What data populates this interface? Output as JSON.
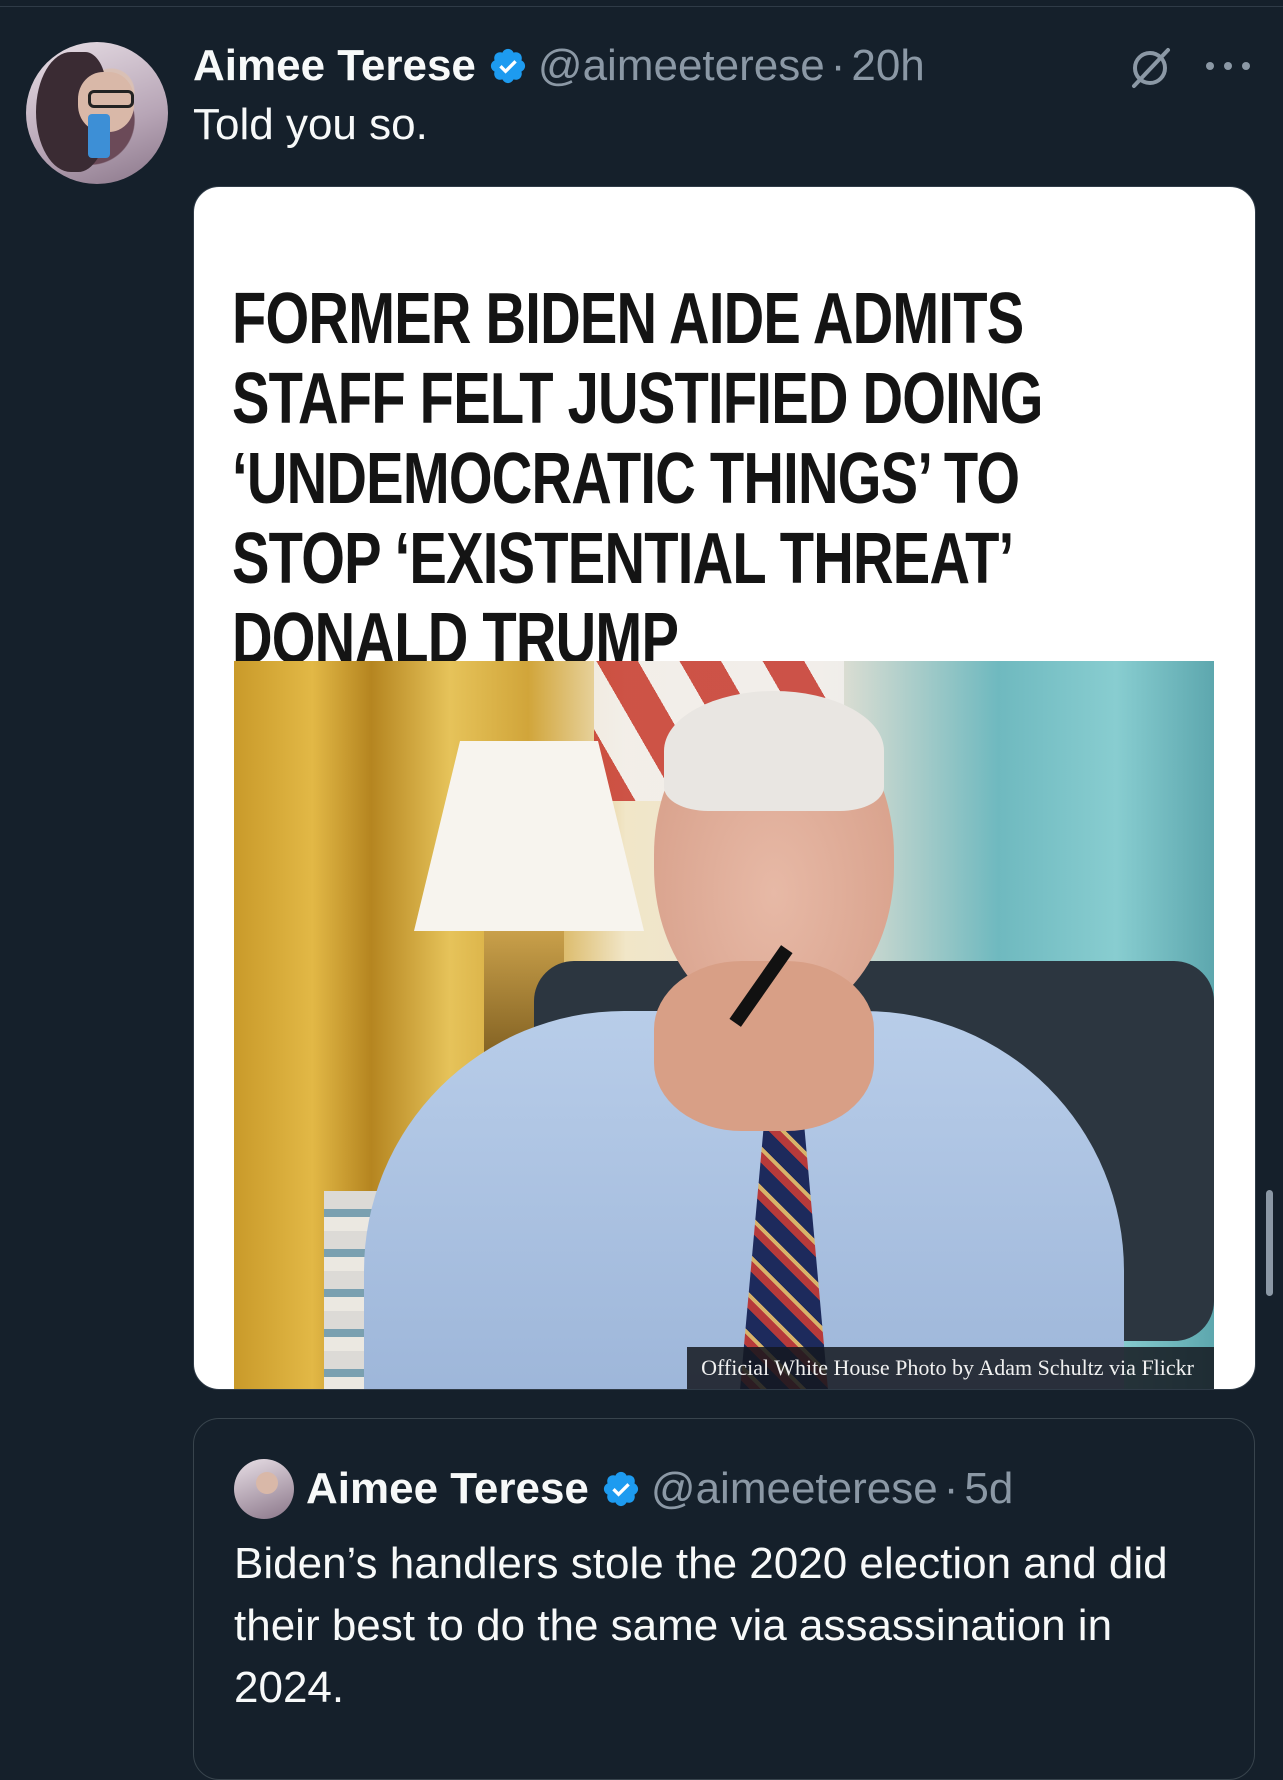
{
  "tweet": {
    "author_name": "Aimee Terese",
    "handle": "@aimeeterese",
    "separator": "·",
    "time": "20h",
    "text": "Told you so.",
    "verified": true,
    "icons": {
      "grok": "grok-icon",
      "more": "more-icon",
      "verified": "verified-badge-icon"
    }
  },
  "media": {
    "headline": "FORMER BIDEN AIDE ADMITS\nSTAFF FELT JUSTIFIED DOING\n‘UNDEMOCRATIC THINGS’ TO\nSTOP ‘EXISTENTIAL THREAT’\nDONALD TRUMP",
    "photo_credit": "Official White House Photo by Adam Schultz via Flickr"
  },
  "quoted_tweet": {
    "author_name": "Aimee Terese",
    "handle": "@aimeeterese",
    "separator": "·",
    "time": "5d",
    "text": "Biden’s handlers stole the 2020 election and did their best to do the same via assassination in 2024.",
    "verified": true
  },
  "colors": {
    "background": "#15202b",
    "secondary_text": "#8b98a5",
    "verified_blue": "#1d9bf0",
    "border": "#38444d"
  }
}
